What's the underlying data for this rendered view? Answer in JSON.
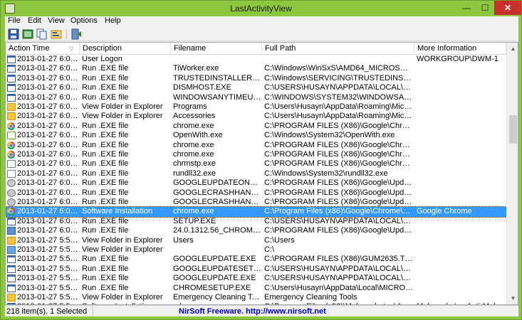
{
  "window": {
    "title": "LastActivityView",
    "minimize": "—",
    "maximize": "☐",
    "close": "✕"
  },
  "menu": [
    "File",
    "Edit",
    "View",
    "Options",
    "Help"
  ],
  "toolbar": [
    "save-icon",
    "html-report-icon",
    "copy-icon",
    "properties-icon",
    "exit-icon"
  ],
  "columns": [
    "Action Time",
    "Description",
    "Filename",
    "Full Path",
    "More Information"
  ],
  "rows": [
    {
      "icon": "exe",
      "time": "2013-01-27 6:04:...",
      "desc": "User Logon",
      "file": "",
      "path": "",
      "more": "WORKGROUP\\DWM-1"
    },
    {
      "icon": "exe",
      "time": "2013-01-27 6:03:...",
      "desc": "Run .EXE file",
      "file": "TiWorker.exe",
      "path": "C:\\Windows\\WinSxS\\AMD64_MICROSOFT-...",
      "more": ""
    },
    {
      "icon": "exe",
      "time": "2013-01-27 6:03:...",
      "desc": "Run .EXE file",
      "file": "TRUSTEDINSTALLER.EXE",
      "path": "C:\\Windows\\SERVICING\\TRUSTEDINSTALL...",
      "more": ""
    },
    {
      "icon": "exe",
      "time": "2013-01-27 6:03:...",
      "desc": "Run .EXE file",
      "file": "DISMHOST.EXE",
      "path": "C:\\USERS\\HUSAYN\\APPDATA\\LOCAL\\TE...",
      "more": ""
    },
    {
      "icon": "exe",
      "time": "2013-01-27 6:03:...",
      "desc": "Run .EXE file",
      "file": "WINDOWSANYTIMEUP...",
      "path": "C:\\WINDOWS\\SYSTEM32\\WINDOWSANYTI...",
      "more": ""
    },
    {
      "icon": "folder",
      "time": "2013-01-27 6:01:...",
      "desc": "View Folder in Explorer",
      "file": "Programs",
      "path": "C:\\Users\\Husayn\\AppData\\Roaming\\Micro...",
      "more": ""
    },
    {
      "icon": "folder",
      "time": "2013-01-27 6:01:...",
      "desc": "View Folder in Explorer",
      "file": "Accessories",
      "path": "C:\\Users\\Husayn\\AppData\\Roaming\\Micro...",
      "more": ""
    },
    {
      "icon": "chrome",
      "time": "2013-01-27 6:00:...",
      "desc": "Run .EXE file",
      "file": "chrome.exe",
      "path": "C:\\PROGRAM FILES (X86)\\Google\\Chrome\\...",
      "more": ""
    },
    {
      "icon": "openwith",
      "time": "2013-01-27 6:00:...",
      "desc": "Run .EXE file",
      "file": "OpenWith.exe",
      "path": "C:\\Windows\\System32\\OpenWith.exe",
      "more": ""
    },
    {
      "icon": "chrome",
      "time": "2013-01-27 6:00:...",
      "desc": "Run .EXE file",
      "file": "chrome.exe",
      "path": "C:\\PROGRAM FILES (X86)\\Google\\Chrome\\...",
      "more": ""
    },
    {
      "icon": "chrome",
      "time": "2013-01-27 6:00:...",
      "desc": "Run .EXE file",
      "file": "chrome.exe",
      "path": "C:\\PROGRAM FILES (X86)\\Google\\Chrome\\...",
      "more": ""
    },
    {
      "icon": "doc",
      "time": "2013-01-27 6:00:...",
      "desc": "Run .EXE file",
      "file": "chrmstp.exe",
      "path": "C:\\PROGRAM FILES (X86)\\Google\\Chrome\\...",
      "more": ""
    },
    {
      "icon": "doc",
      "time": "2013-01-27 6:00:...",
      "desc": "Run .EXE file",
      "file": "rundll32.exe",
      "path": "C:\\Windows\\System32\\rundll32.exe",
      "more": ""
    },
    {
      "icon": "gear",
      "time": "2013-01-27 6:00:...",
      "desc": "Run .EXE file",
      "file": "GOOGLEUPDATEONDE...",
      "path": "C:\\PROGRAM FILES (X86)\\Google\\Update\\...",
      "more": ""
    },
    {
      "icon": "gear",
      "time": "2013-01-27 6:00:...",
      "desc": "Run .EXE file",
      "file": "GOOGLECRASHHANDL...",
      "path": "C:\\PROGRAM FILES (X86)\\Google\\Update\\...",
      "more": ""
    },
    {
      "icon": "gear",
      "time": "2013-01-27 6:00:...",
      "desc": "Run .EXE file",
      "file": "GOOGLECRASHHANDL...",
      "path": "C:\\PROGRAM FILES (X86)\\Google\\Update\\...",
      "more": ""
    },
    {
      "icon": "chrome",
      "time": "2013-01-27 6:00:...",
      "desc": "Software Installation",
      "file": "chrome.exe",
      "path": "C:\\Program Files (x86)\\Google\\Chrome\\Ap...",
      "more": "Google Chrome",
      "selected": true
    },
    {
      "icon": "exe",
      "time": "2013-01-27 6:00:...",
      "desc": "Run .EXE file",
      "file": "SETUP.EXE",
      "path": "C:\\USERS\\HUSAYN\\APPDATA\\LOCAL\\TE...",
      "more": ""
    },
    {
      "icon": "inst",
      "time": "2013-01-27 6:00:...",
      "desc": "Run .EXE file",
      "file": "24.0.1312.56_CHROME_I...",
      "path": "C:\\PROGRAM FILES (X86)\\Google\\Update\\...",
      "more": ""
    },
    {
      "icon": "folder",
      "time": "2013-01-27 5:59:...",
      "desc": "View Folder in Explorer",
      "file": "Users",
      "path": "C:\\Users",
      "more": ""
    },
    {
      "icon": "net",
      "time": "2013-01-27 5:59:...",
      "desc": "View Folder in Explorer",
      "file": "",
      "path": "C:\\",
      "more": ""
    },
    {
      "icon": "exe",
      "time": "2013-01-27 5:59:...",
      "desc": "Run .EXE file",
      "file": "GOOGLEUPDATE.EXE",
      "path": "C:\\PROGRAM FILES (X86)\\GUM2635.TMP\\...",
      "more": ""
    },
    {
      "icon": "exe",
      "time": "2013-01-27 5:59:...",
      "desc": "Run .EXE file",
      "file": "GOOGLEUPDATESETUP...",
      "path": "C:\\USERS\\HUSAYN\\APPDATA\\LOCAL\\TE...",
      "more": ""
    },
    {
      "icon": "exe",
      "time": "2013-01-27 5:59:...",
      "desc": "Run .EXE file",
      "file": "GOOGLEUPDATE.EXE",
      "path": "C:\\USERS\\HUSAYN\\APPDATA\\LOCAL\\TE...",
      "more": ""
    },
    {
      "icon": "exe",
      "time": "2013-01-27 5:59:...",
      "desc": "Run .EXE file",
      "file": "CHROMESETUP.EXE",
      "path": "C:\\Users\\Husayn\\AppData\\Local\\MICROS...",
      "more": ""
    },
    {
      "icon": "folder",
      "time": "2013-01-27 5:59:...",
      "desc": "View Folder in Explorer",
      "file": "Emergency Cleaning To...",
      "path": "Emergency Cleaning Tools",
      "more": ""
    },
    {
      "icon": "exe",
      "time": "2013-01-27 5:58:...",
      "desc": "Software Installation",
      "file": "mbam.exe",
      "path": "C:\\Program Files (x86)\\Malwarebytes' Anti-...",
      "more": "Malwarebytes Anti-Mal..."
    }
  ],
  "status": {
    "count": "218 item(s), 1 Selected",
    "link": "NirSoft Freeware.  http://www.nirsoft.net"
  },
  "colors": {
    "titlebar": "#8dc63f",
    "selection": "#3399ff",
    "close": "#c7302b"
  }
}
